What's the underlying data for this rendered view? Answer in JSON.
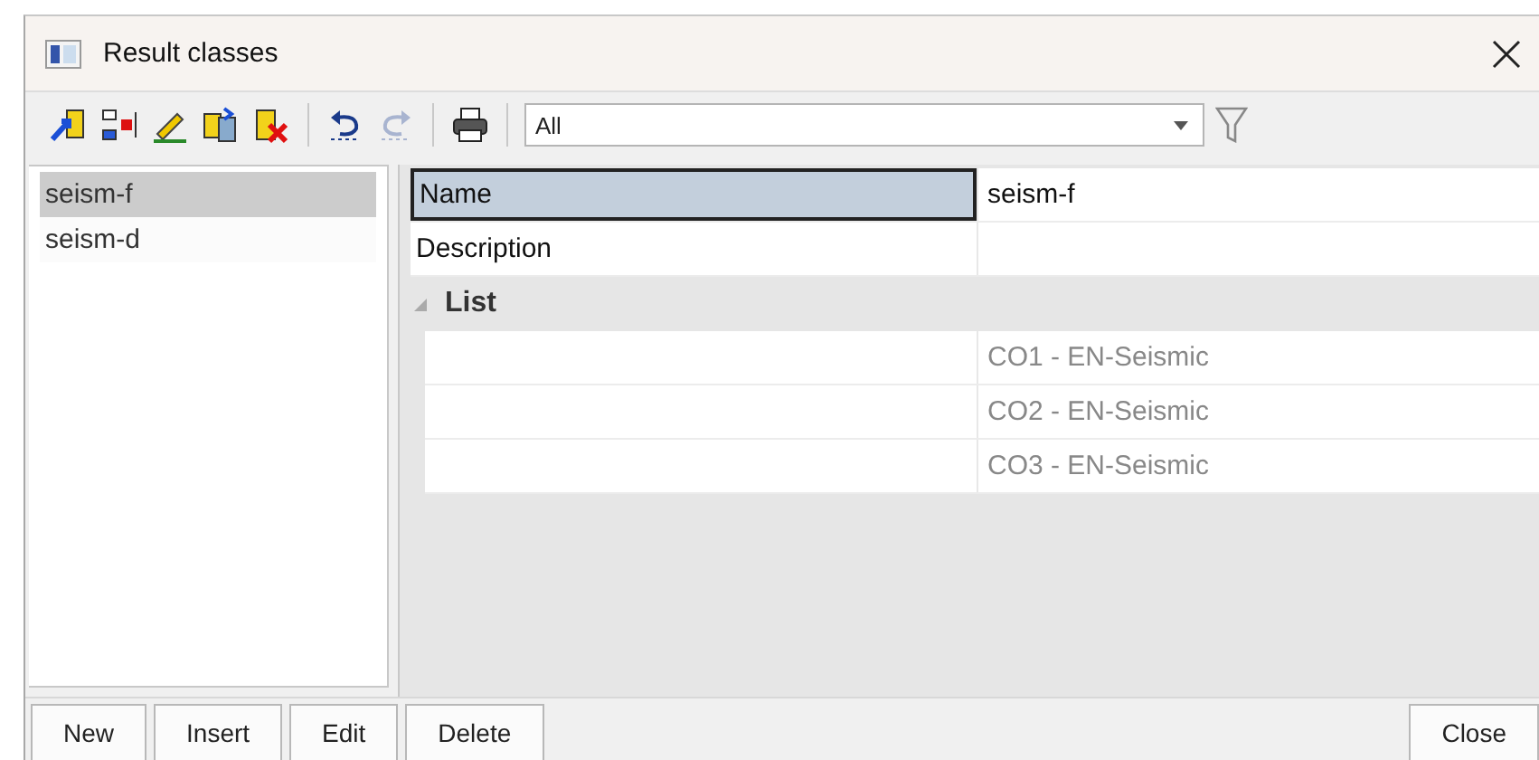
{
  "window": {
    "title": "Result classes"
  },
  "toolbar": {
    "filter": {
      "value": "All"
    }
  },
  "sidebar": {
    "items": [
      {
        "label": "seism-f",
        "selected": true
      },
      {
        "label": "seism-d",
        "selected": false
      }
    ]
  },
  "properties": [
    {
      "name": "Name",
      "value": "seism-f",
      "selected": true
    },
    {
      "name": "Description",
      "selected": false
    }
  ],
  "list_group": {
    "label": "List",
    "expanded": true,
    "rows": [
      {
        "value": "CO1 - EN-Seismic"
      },
      {
        "value": "CO2 - EN-Seismic"
      },
      {
        "value": "CO3 - EN-Seismic"
      }
    ]
  },
  "buttons": [
    {
      "label": "New"
    },
    {
      "label": "Insert"
    },
    {
      "label": "Edit"
    },
    {
      "label": "Delete"
    }
  ],
  "close_button": {
    "label": "Close"
  }
}
